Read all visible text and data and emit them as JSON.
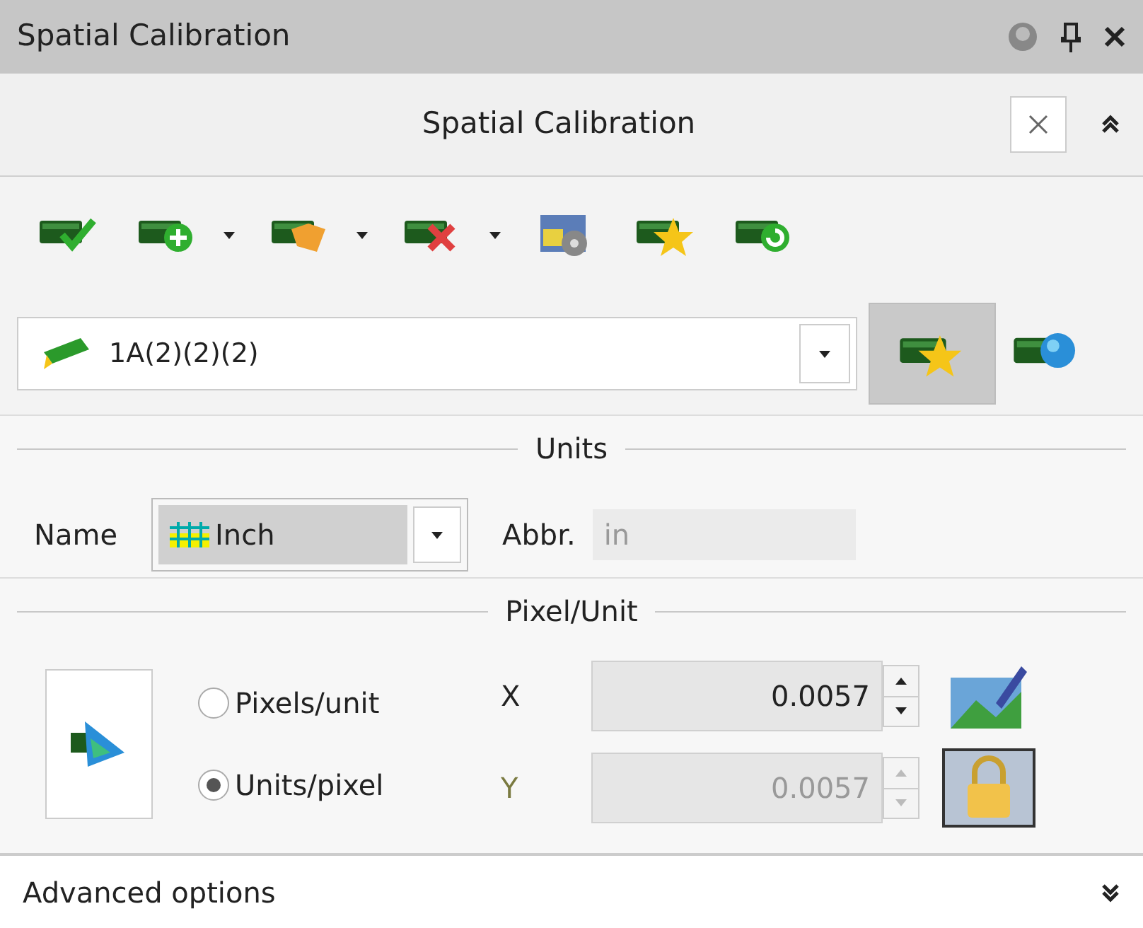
{
  "window": {
    "title": "Spatial Calibration"
  },
  "header": {
    "title": "Spatial Calibration"
  },
  "toolbar": [
    {
      "dropdown": false
    },
    {
      "dropdown": true
    },
    {
      "dropdown": true
    },
    {
      "dropdown": true
    },
    {
      "dropdown": false
    },
    {
      "dropdown": false
    },
    {
      "dropdown": false
    }
  ],
  "calibration": {
    "value": "1A(2)(2)(2)",
    "favorite_pressed": true
  },
  "units": {
    "title": "Units",
    "name_label": "Name",
    "name_value": "Inch",
    "abbr_label": "Abbr.",
    "abbr_value": "in",
    "abbr_disabled": true
  },
  "pixel_unit": {
    "title": "Pixel/Unit",
    "modes": [
      {
        "label": "Pixels/unit",
        "selected": false
      },
      {
        "label": "Units/pixel",
        "selected": true
      }
    ],
    "axes": [
      {
        "label": "X",
        "value": "0.0057",
        "disabled": false
      },
      {
        "label": "Y",
        "value": "0.0057",
        "disabled": true
      }
    ],
    "lock_pressed": true
  },
  "advanced": {
    "label": "Advanced options",
    "expanded": false
  }
}
